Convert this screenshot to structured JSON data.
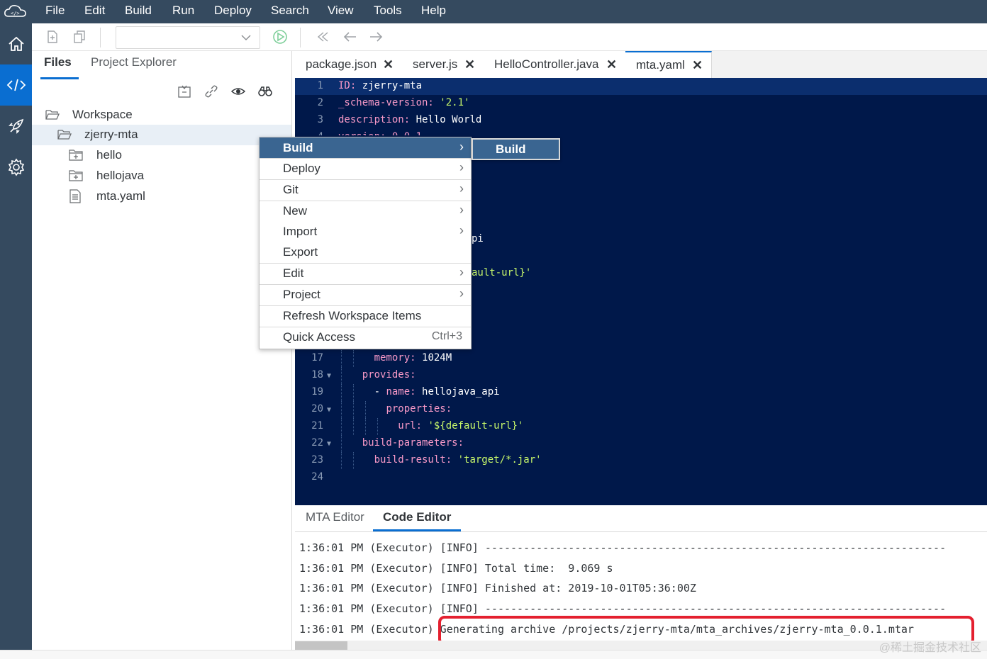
{
  "menubar": {
    "items": [
      "File",
      "Edit",
      "Build",
      "Run",
      "Deploy",
      "Search",
      "View",
      "Tools",
      "Help"
    ]
  },
  "activity_bar": {
    "icons": [
      "home-icon",
      "code-icon",
      "rocket-icon",
      "settings-icon"
    ],
    "active": "code-icon"
  },
  "toolbar": {
    "icons": [
      "new-file-icon",
      "copy-icon",
      "run-icon",
      "step-back-icon",
      "back-arrow-icon",
      "forward-arrow-icon"
    ],
    "run_config_value": ""
  },
  "left_panel": {
    "tabs": [
      "Files",
      "Project Explorer"
    ],
    "active_tab": "Files",
    "action_icons": [
      "collapse-icon",
      "link-icon",
      "eye-icon",
      "binoculars-icon"
    ],
    "tree": [
      {
        "label": "Workspace",
        "icon": "folder-open-icon",
        "depth": 0
      },
      {
        "label": "zjerry-mta",
        "icon": "folder-open-icon",
        "depth": 1,
        "selected": true
      },
      {
        "label": "hello",
        "icon": "module-folder-icon",
        "depth": 2
      },
      {
        "label": "hellojava",
        "icon": "module-folder-icon",
        "depth": 2
      },
      {
        "label": "mta.yaml",
        "icon": "document-icon",
        "depth": 2
      }
    ]
  },
  "editor": {
    "tabs": [
      {
        "label": "package.json"
      },
      {
        "label": "server.js"
      },
      {
        "label": "HelloController.java"
      },
      {
        "label": "mta.yaml",
        "active": true
      }
    ],
    "close_glyph": "✕",
    "lines": [
      {
        "n": "1",
        "key": "ID",
        "val": "zjerry-mta",
        "type": "plain",
        "indent": 0
      },
      {
        "n": "2",
        "key": "_schema-version",
        "val": "'2.1'",
        "type": "string",
        "indent": 0
      },
      {
        "n": "3",
        "key": "description",
        "val": "Hello World",
        "type": "plain",
        "indent": 0
      },
      {
        "n": "17",
        "key": "memory",
        "val": "1024M",
        "type": "plain",
        "indent": 3
      },
      {
        "n": "18",
        "key": "provides",
        "val": "",
        "type": "plain",
        "indent": 2,
        "fold": true
      },
      {
        "n": "19",
        "key": "name",
        "val": "hellojava_api",
        "type": "plain",
        "indent": 3,
        "dash": true
      },
      {
        "n": "20",
        "key": "properties",
        "val": "",
        "type": "plain",
        "indent": 4,
        "fold": true
      },
      {
        "n": "21",
        "key": "url",
        "val": "'${default-url}'",
        "type": "string",
        "indent": 5
      },
      {
        "n": "22",
        "key": "build-parameters",
        "val": "",
        "type": "plain",
        "indent": 2,
        "fold": true
      },
      {
        "n": "23",
        "key": "build-result",
        "val": "'target/*.jar'",
        "type": "string",
        "indent": 3
      },
      {
        "n": "24",
        "key": "",
        "val": "",
        "type": "plain",
        "indent": 0
      }
    ],
    "partial_line_4_number": "4",
    "partial_line_4_text": "version: 0.0.1",
    "fragment_api": "pi",
    "fragment_url": "ault-url}'"
  },
  "bottom_tabs": {
    "items": [
      "MTA Editor",
      "Code Editor"
    ],
    "active": "Code Editor"
  },
  "console": {
    "lines": [
      "1:36:01 PM (Executor) [INFO] ------------------------------------------------------------------------",
      "1:36:01 PM (Executor) [INFO] Total time:  9.069 s",
      "1:36:01 PM (Executor) [INFO] Finished at: 2019-10-01T05:36:00Z",
      "1:36:01 PM (Executor) [INFO] ------------------------------------------------------------------------",
      "1:36:01 PM (Executor) Generating archive /projects/zjerry-mta/mta_archives/zjerry-mta_0.0.1.mtar"
    ],
    "highlight_color": "#e4202f"
  },
  "context_menu": {
    "items": [
      {
        "label": "Build",
        "submenu": true,
        "active": true
      },
      {
        "label": "Deploy",
        "submenu": true
      },
      {
        "label": "Git",
        "submenu": true
      },
      {
        "label": "New",
        "submenu": true
      },
      {
        "label": "Import",
        "submenu": true
      },
      {
        "label": "Export",
        "submenu": false
      },
      {
        "label": "Edit",
        "submenu": true
      },
      {
        "label": "Project",
        "submenu": true
      },
      {
        "label": "Refresh Workspace Items",
        "submenu": false
      },
      {
        "label": "Quick Access",
        "submenu": false,
        "shortcut": "Ctrl+3"
      }
    ],
    "arrow_glyph": "›"
  },
  "submenu": {
    "items": [
      {
        "label": "Build"
      }
    ]
  },
  "watermark": "@稀土掘金技术社区",
  "colors": {
    "shell": "#354a5f",
    "accent": "#0a6ed1",
    "editor_bg": "#00184a",
    "menu_active": "#3a6591",
    "yaml_key": "#f799c7",
    "yaml_string": "#c7f76a"
  }
}
